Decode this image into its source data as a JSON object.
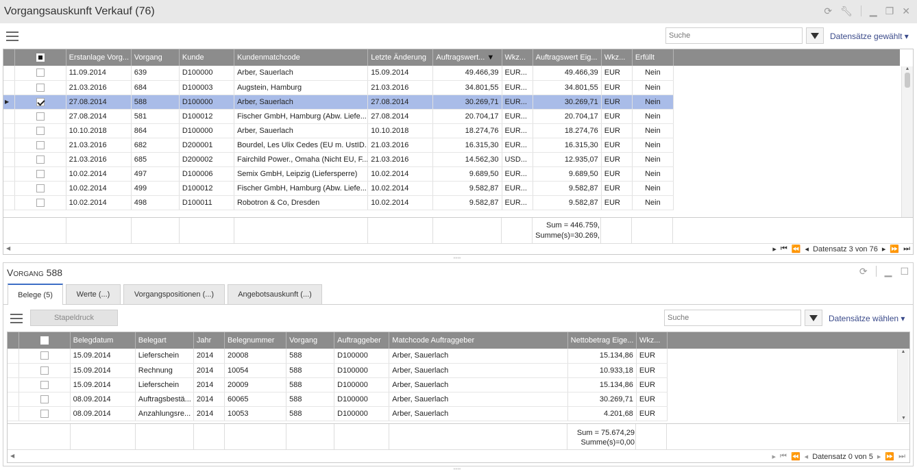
{
  "window": {
    "title": "Vorgangsauskunft Verkauf (76)"
  },
  "top": {
    "search_placeholder": "Suche",
    "records_selected": "Datensätze gewählt",
    "columns": [
      "",
      "Erstanlage Vorg...",
      "Vorgang",
      "Kunde",
      "Kundenmatchcode",
      "Letzte Änderung",
      "Auftragswert...",
      "Wkz...",
      "Auftragswert Eig...",
      "Wkz...",
      "Erfüllt"
    ],
    "rows": [
      {
        "checked": false,
        "date": "11.09.2014",
        "vorgang": "639",
        "kunde": "D100000",
        "match": "Arber, Sauerlach",
        "changed": "15.09.2014",
        "wert": "49.466,39",
        "wkz": "EUR...",
        "wert_eig": "49.466,39",
        "wkz2": "EUR",
        "erfuellt": "Nein"
      },
      {
        "checked": false,
        "date": "21.03.2016",
        "vorgang": "684",
        "kunde": "D100003",
        "match": "Augstein, Hamburg",
        "changed": "21.03.2016",
        "wert": "34.801,55",
        "wkz": "EUR...",
        "wert_eig": "34.801,55",
        "wkz2": "EUR",
        "erfuellt": "Nein"
      },
      {
        "checked": true,
        "date": "27.08.2014",
        "vorgang": "588",
        "kunde": "D100000",
        "match": "Arber, Sauerlach",
        "changed": "27.08.2014",
        "wert": "30.269,71",
        "wkz": "EUR...",
        "wert_eig": "30.269,71",
        "wkz2": "EUR",
        "erfuellt": "Nein"
      },
      {
        "checked": false,
        "date": "27.08.2014",
        "vorgang": "581",
        "kunde": "D100012",
        "match": "Fischer GmbH, Hamburg (Abw. Liefe...",
        "changed": "27.08.2014",
        "wert": "20.704,17",
        "wkz": "EUR...",
        "wert_eig": "20.704,17",
        "wkz2": "EUR",
        "erfuellt": "Nein"
      },
      {
        "checked": false,
        "date": "10.10.2018",
        "vorgang": "864",
        "kunde": "D100000",
        "match": "Arber, Sauerlach",
        "changed": "10.10.2018",
        "wert": "18.274,76",
        "wkz": "EUR...",
        "wert_eig": "18.274,76",
        "wkz2": "EUR",
        "erfuellt": "Nein"
      },
      {
        "checked": false,
        "date": "21.03.2016",
        "vorgang": "682",
        "kunde": "D200001",
        "match": "Bourdel, Les Ulix Cedes (EU m. UstID...",
        "changed": "21.03.2016",
        "wert": "16.315,30",
        "wkz": "EUR...",
        "wert_eig": "16.315,30",
        "wkz2": "EUR",
        "erfuellt": "Nein"
      },
      {
        "checked": false,
        "date": "21.03.2016",
        "vorgang": "685",
        "kunde": "D200002",
        "match": "Fairchild Power., Omaha (Nicht EU, F...",
        "changed": "21.03.2016",
        "wert": "14.562,30",
        "wkz": "USD...",
        "wert_eig": "12.935,07",
        "wkz2": "EUR",
        "erfuellt": "Nein"
      },
      {
        "checked": false,
        "date": "10.02.2014",
        "vorgang": "497",
        "kunde": "D100006",
        "match": "Semix GmbH, Leipzig (Liefersperre)",
        "changed": "10.02.2014",
        "wert": "9.689,50",
        "wkz": "EUR...",
        "wert_eig": "9.689,50",
        "wkz2": "EUR",
        "erfuellt": "Nein"
      },
      {
        "checked": false,
        "date": "10.02.2014",
        "vorgang": "499",
        "kunde": "D100012",
        "match": "Fischer GmbH, Hamburg (Abw. Liefe...",
        "changed": "10.02.2014",
        "wert": "9.582,87",
        "wkz": "EUR...",
        "wert_eig": "9.582,87",
        "wkz2": "EUR",
        "erfuellt": "Nein"
      },
      {
        "checked": false,
        "date": "10.02.2014",
        "vorgang": "498",
        "kunde": "D100011",
        "match": "Robotron & Co, Dresden",
        "changed": "10.02.2014",
        "wert": "9.582,87",
        "wkz": "EUR...",
        "wert_eig": "9.582,87",
        "wkz2": "EUR",
        "erfuellt": "Nein"
      }
    ],
    "sum1": "Sum = 446.759,",
    "sum2": "Summe(s)=30.269,",
    "pager": "Datensatz 3 von 76"
  },
  "bottom": {
    "title": "Vorgang 588",
    "tabs": [
      "Belege (5)",
      "Werte (...)",
      "Vorgangspositionen (...)",
      "Angebotsauskunft (...)"
    ],
    "stapeldruck": "Stapeldruck",
    "search_placeholder": "Suche",
    "records_select": "Datensätze wählen",
    "columns": [
      "",
      "Belegdatum",
      "Belegart",
      "Jahr",
      "Belegnummer",
      "Vorgang",
      "Auftraggeber",
      "Matchcode Auftraggeber",
      "Nettobetrag Eige...",
      "Wkz..."
    ],
    "rows": [
      {
        "date": "15.09.2014",
        "art": "Lieferschein",
        "jahr": "2014",
        "nr": "20008",
        "vorgang": "588",
        "ag": "D100000",
        "match": "Arber, Sauerlach",
        "netto": "15.134,86",
        "wkz": "EUR"
      },
      {
        "date": "15.09.2014",
        "art": "Rechnung",
        "jahr": "2014",
        "nr": "10054",
        "vorgang": "588",
        "ag": "D100000",
        "match": "Arber, Sauerlach",
        "netto": "10.933,18",
        "wkz": "EUR"
      },
      {
        "date": "15.09.2014",
        "art": "Lieferschein",
        "jahr": "2014",
        "nr": "20009",
        "vorgang": "588",
        "ag": "D100000",
        "match": "Arber, Sauerlach",
        "netto": "15.134,86",
        "wkz": "EUR"
      },
      {
        "date": "08.09.2014",
        "art": "Auftragsbestä...",
        "jahr": "2014",
        "nr": "60065",
        "vorgang": "588",
        "ag": "D100000",
        "match": "Arber, Sauerlach",
        "netto": "30.269,71",
        "wkz": "EUR"
      },
      {
        "date": "08.09.2014",
        "art": "Anzahlungsre...",
        "jahr": "2014",
        "nr": "10053",
        "vorgang": "588",
        "ag": "D100000",
        "match": "Arber, Sauerlach",
        "netto": "4.201,68",
        "wkz": "EUR"
      }
    ],
    "sum1": "Sum = 75.674,29",
    "sum2": "Summe(s)=0,00",
    "pager": "Datensatz 0 von 5"
  }
}
